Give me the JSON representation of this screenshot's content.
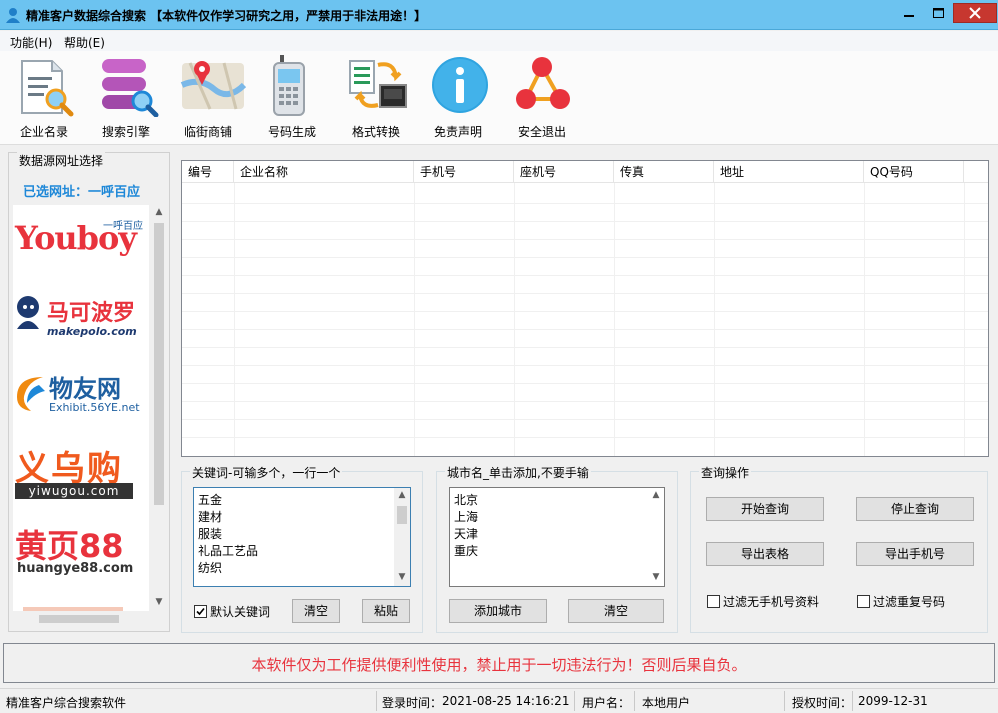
{
  "window": {
    "title": "精准客户数据综合搜索 【本软件仅作学习研究之用，严禁用于非法用途！】"
  },
  "menu": {
    "items": [
      "功能(H)",
      "帮助(E)"
    ]
  },
  "toolbar": {
    "items": [
      "企业名录",
      "搜索引擎",
      "临街商铺",
      "号码生成",
      "格式转换",
      "免责声明",
      "安全退出"
    ]
  },
  "source_panel": {
    "title": "数据源网址选择",
    "selected_label": "已选网址：一呼百应",
    "logos": [
      {
        "brand": "Youboy",
        "tag": "一呼百应"
      },
      {
        "brand": "马可波罗",
        "tag": "makepolo.com"
      },
      {
        "brand": "物友网",
        "tag": "Exhibit.56YE.net"
      },
      {
        "brand": "义乌购",
        "tag": "yiwugou.com"
      },
      {
        "brand": "黄页88",
        "tag": "huangye88.com"
      }
    ]
  },
  "grid": {
    "columns": [
      "编号",
      "企业名称",
      "手机号",
      "座机号",
      "传真",
      "地址",
      "QQ号码"
    ]
  },
  "keywords": {
    "title": "关键词-可输多个，一行一个",
    "items": [
      "五金",
      "建材",
      "服装",
      "礼品工艺品",
      "纺织"
    ],
    "default_checkbox": "默认关键词",
    "clear_button": "清空",
    "paste_button": "粘贴"
  },
  "cities": {
    "title": "城市名_单击添加,不要手输",
    "items": [
      "北京",
      "上海",
      "天津",
      "重庆"
    ],
    "add_button": "添加城市",
    "clear_button": "清空"
  },
  "query": {
    "title": "查询操作",
    "start_button": "开始查询",
    "stop_button": "停止查询",
    "export_table_button": "导出表格",
    "export_phone_button": "导出手机号",
    "filter_no_phone": "过滤无手机号资料",
    "filter_duplicate": "过滤重复号码"
  },
  "notice": {
    "text": "本软件仅为工作提供便利性使用，禁止用于一切违法行为！否则后果自负。",
    "color": "#e8333d"
  },
  "status": {
    "app_name": "精准客户综合搜索软件",
    "login_label": "登录时间：",
    "login_time": "2021-08-25 14:16:21",
    "user_label": "用户名：",
    "user_name": "本地用户",
    "auth_label": "授权时间：",
    "auth_time": "2099-12-31"
  },
  "colors": {
    "titlebar": "#6cc3f0",
    "accent_blue": "#1e88d8",
    "close_red": "#c7372f"
  }
}
